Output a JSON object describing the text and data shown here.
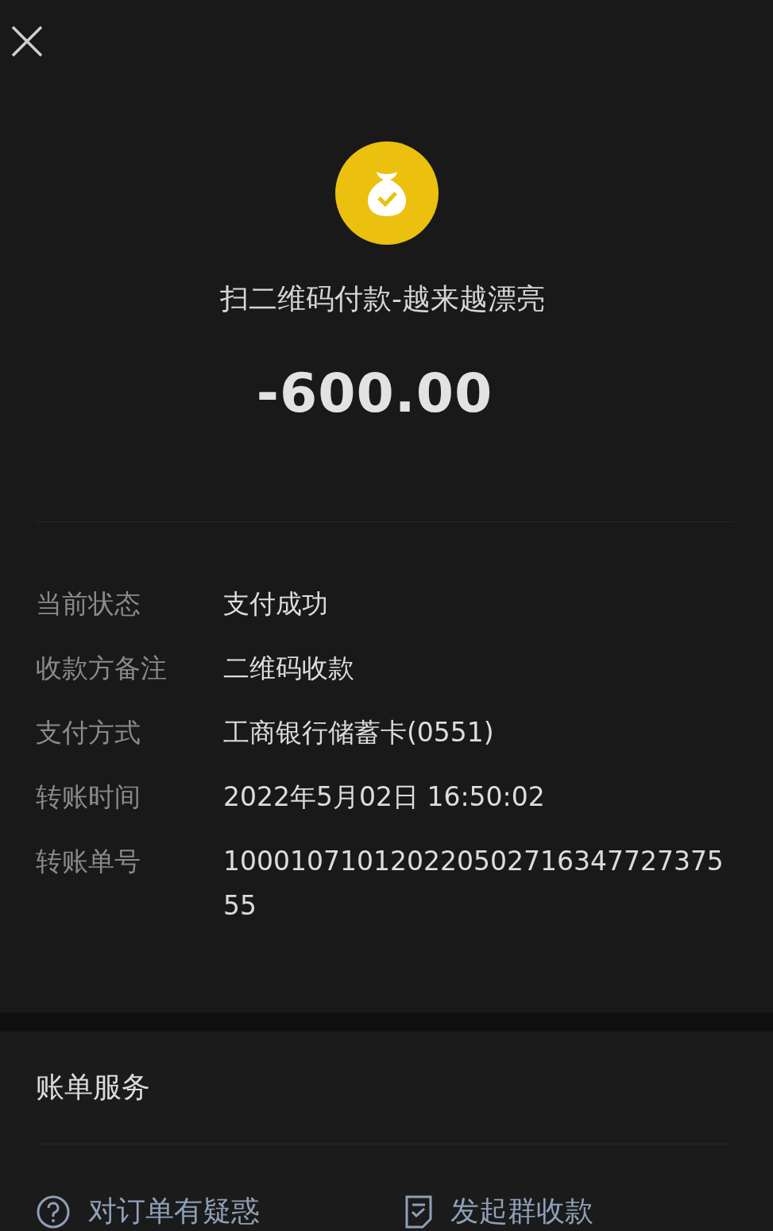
{
  "payment": {
    "title": "扫二维码付款-越来越漂亮",
    "amount": "-600.00"
  },
  "details": [
    {
      "label": "当前状态",
      "value": "支付成功"
    },
    {
      "label": "收款方备注",
      "value": "二维码收款"
    },
    {
      "label": "支付方式",
      "value": "工商银行储蓄卡(0551)"
    },
    {
      "label": "转账时间",
      "value": "2022年5月02日 16:50:02"
    },
    {
      "label": "转账单号",
      "value": "10001071012022050271634772737555"
    }
  ],
  "services": {
    "title": "账单服务",
    "actions": [
      {
        "kind": "question",
        "label": "对订单有疑惑"
      },
      {
        "kind": "bill",
        "label": "发起群收款"
      }
    ]
  }
}
